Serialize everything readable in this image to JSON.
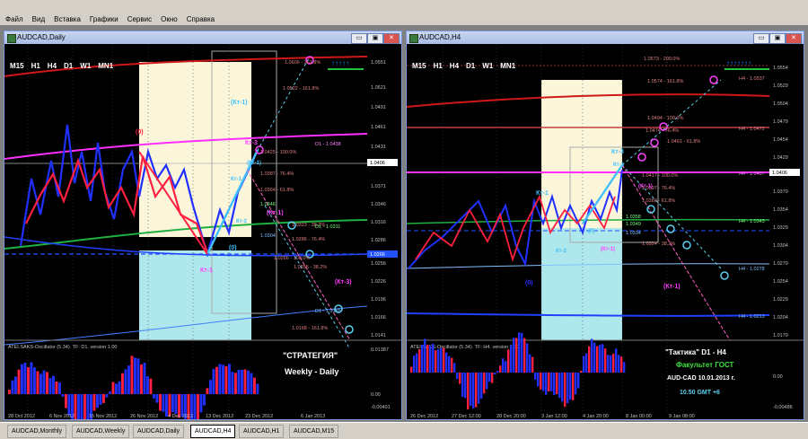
{
  "menu": [
    "Файл",
    "Вид",
    "Вставка",
    "Графики",
    "Сервис",
    "Окно",
    "Справка"
  ],
  "timeframes": [
    "M15",
    "H1",
    "H4",
    "D1",
    "W1",
    "MN1"
  ],
  "window_buttons": {
    "minimize": "▭",
    "restore": "▣",
    "close": "✕"
  },
  "left": {
    "title": "AUDCAD,Daily",
    "price_axis": [
      "1.0551",
      "1.0521",
      "1.0491",
      "1.0461",
      "1.0431",
      "1.0406",
      "1.0371",
      "1.0346",
      "1.0316",
      "1.0286",
      "1.0266",
      "1.0256",
      "1.0226",
      "1.0196",
      "1.0166",
      "1.0141"
    ],
    "price_tag": "1.0406",
    "price_tag2": "1.0266",
    "levels": [
      "1.0606 - 261.8%",
      "1.0522 - 161.8%",
      "1.0425 - 100.0%",
      "1.0387 - 76.4%",
      "1.0364 - 61.8%",
      "1.0346",
      "1.0323 - 38.2%",
      "1.0304",
      "1.0286 - 76.4%",
      "1.0266 - 100.0%",
      "1.0255 - 38.2%",
      "1.0168 - 161.8%",
      "D1 - 1.0438",
      "D1 - 1.0311",
      "D1 - 1.0185"
    ],
    "labels": {
      "zero_top": "(0)",
      "kt1": "Кт-1",
      "kt3": "Кт-3",
      "kt3b": "(Кт-1)",
      "kt3c": "(Кт-1)",
      "zero_bottom": "(0)",
      "kt2": "Кт-2",
      "kt1b": "Кт-1",
      "kt3d": "(Кт-3)",
      "ktx": "(Кт-1)"
    },
    "indicator_title": "ATEI.SAKS-Oscillator (5.34). TF: D1. version 1.00",
    "indicator_axis": [
      "0.01387",
      "0.00",
      "-0.00401"
    ],
    "strategy": "\"СТРАТЕГИЯ\"",
    "strategy2": "Weekly - Daily",
    "dates": [
      "28 Oct 2012",
      "6 Nov 2012",
      "15 Nov 2012",
      "26 Nov 2012",
      "4 Dec 2012",
      "13 Dec 2012",
      "23 Dec 2012",
      "6 Jan 2013"
    ]
  },
  "right": {
    "title": "AUDCAD,H4",
    "price_axis": [
      "1.0554",
      "1.0529",
      "1.0504",
      "1.0479",
      "1.0454",
      "1.0429",
      "1.0406",
      "1.0379",
      "1.0354",
      "1.0329",
      "1.0304",
      "1.0279",
      "1.0254",
      "1.0229",
      "1.0204",
      "1.0179"
    ],
    "price_tag": "1.0406",
    "levels": [
      "1.0573 - 200.0%",
      "1.0574 - 161.8%",
      "1.0494 - 100.0%",
      "1.0474 - 76.4%",
      "1.0461 - 61.8%",
      "1.0417 - 100.0%",
      "1.0397 - 76.4%",
      "1.0380 - 61.8%",
      "1.0358",
      "1.0349",
      "1.0334",
      "1.0324 - 38.2%",
      "H4 - 1.0537",
      "H4 - 1.0472",
      "H4 - 1.0407",
      "H4 - 1.0343",
      "H4 - 1.0278",
      "H4 - 1.0213"
    ],
    "labels": {
      "kt3": "Кт-3",
      "kt1": "Кт-1",
      "kt2": "Кт-2",
      "zero": "(0)",
      "zero2": "(0)",
      "kt3b": "Кт-3",
      "kt1b": "(Кт-1)",
      "kt1c": "(Кт-1)",
      "kt1d": "(Кт-1)"
    },
    "indicator_title": "ATEI.SAKS-Oscillator (5.34). TF: H4. version 1.00",
    "indicator_axis": [
      "0.00",
      "-0.00486"
    ],
    "tactic": "\"Тактика\"  D1 - H4",
    "faculty": "Факультет ГОСТ",
    "pair_date": "AUD-CAD   10.01.2013  г.",
    "time": "10.50   GMT +6",
    "dates": [
      "26 Dec 2012",
      "27 Dec 12:00",
      "28 Dec 20:00",
      "3 Jan 12:00",
      "4 Jan 20:00",
      "8 Jan 00:00",
      "9 Jan 08:00"
    ]
  },
  "tabs": [
    "AUDCAD,Monthly",
    "AUDCAD,Weekly",
    "AUDCAD,Daily",
    "AUDCAD,H4",
    "AUDCAD,H1",
    "AUDCAD,M15"
  ],
  "active_tab": "AUDCAD,H4",
  "colors": {
    "bg": "#000000",
    "grid": "#3a3a3a",
    "up": "#ff2040",
    "down": "#2040ff",
    "cyan": "#5ad0f0",
    "magenta": "#ff40ff",
    "green": "#20c040"
  }
}
